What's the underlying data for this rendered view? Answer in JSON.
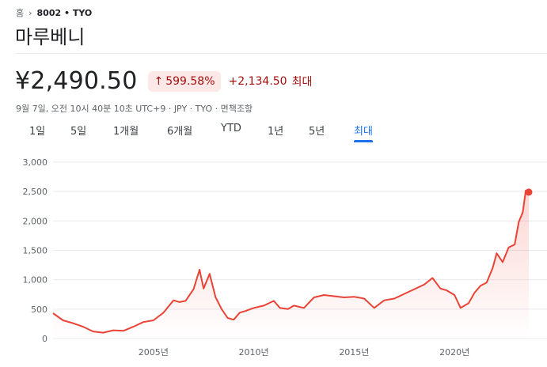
{
  "breadcrumb": {
    "home": "홈",
    "ticker": "8002 • TYO"
  },
  "company_name": "마루베니",
  "quote": {
    "price": "¥2,490.50",
    "change_pct": "599.58%",
    "change_abs": "+2,134.50",
    "period": "최대",
    "meta": "9월 7일, 오전 10시 40분 10초 UTC+9 · JPY · TYO · 면책조항"
  },
  "tabs": [
    {
      "label": "1일"
    },
    {
      "label": "5일"
    },
    {
      "label": "1개월"
    },
    {
      "label": "6개월"
    },
    {
      "label": "YTD"
    },
    {
      "label": "1년"
    },
    {
      "label": "5년"
    },
    {
      "label": "최대"
    }
  ],
  "active_tab": 7,
  "colors": {
    "line": "#ea4335",
    "negative_text": "#a50e0e",
    "badge_bg": "#fce8e6",
    "accent": "#1a73e8"
  },
  "chart_data": {
    "type": "area",
    "ylim": [
      0,
      3000
    ],
    "xlim": [
      2000.0,
      2023.7
    ],
    "y_ticks": [
      "0",
      "500",
      "1,000",
      "1,500",
      "2,000",
      "2,500",
      "3,000"
    ],
    "y_tick_values": [
      0,
      500,
      1000,
      1500,
      2000,
      2500,
      3000
    ],
    "x_ticks": [
      "2005년",
      "2010년",
      "2015년",
      "2020년"
    ],
    "x_tick_values": [
      2005,
      2010,
      2015,
      2020
    ],
    "x": [
      2000.0,
      2000.5,
      2001.0,
      2001.5,
      2002.0,
      2002.5,
      2003.0,
      2003.5,
      2004.0,
      2004.5,
      2005.0,
      2005.5,
      2006.0,
      2006.3,
      2006.6,
      2007.0,
      2007.3,
      2007.5,
      2007.8,
      2008.1,
      2008.4,
      2008.7,
      2009.0,
      2009.3,
      2009.6,
      2010.0,
      2010.5,
      2011.0,
      2011.3,
      2011.7,
      2012.0,
      2012.5,
      2013.0,
      2013.5,
      2014.0,
      2014.5,
      2015.0,
      2015.5,
      2016.0,
      2016.5,
      2017.0,
      2017.5,
      2018.0,
      2018.5,
      2018.9,
      2019.3,
      2019.6,
      2020.0,
      2020.3,
      2020.7,
      2021.0,
      2021.3,
      2021.6,
      2021.9,
      2022.1,
      2022.4,
      2022.7,
      2023.0,
      2023.2,
      2023.4,
      2023.55,
      2023.7
    ],
    "values": [
      430,
      310,
      260,
      200,
      120,
      100,
      140,
      130,
      200,
      280,
      310,
      440,
      650,
      620,
      640,
      840,
      1170,
      850,
      1100,
      700,
      500,
      350,
      320,
      440,
      470,
      520,
      560,
      640,
      520,
      500,
      560,
      520,
      700,
      740,
      720,
      700,
      710,
      680,
      520,
      650,
      680,
      760,
      840,
      920,
      1030,
      850,
      820,
      740,
      520,
      600,
      780,
      900,
      950,
      1200,
      1450,
      1300,
      1550,
      1600,
      1980,
      2150,
      2520,
      2490
    ]
  }
}
